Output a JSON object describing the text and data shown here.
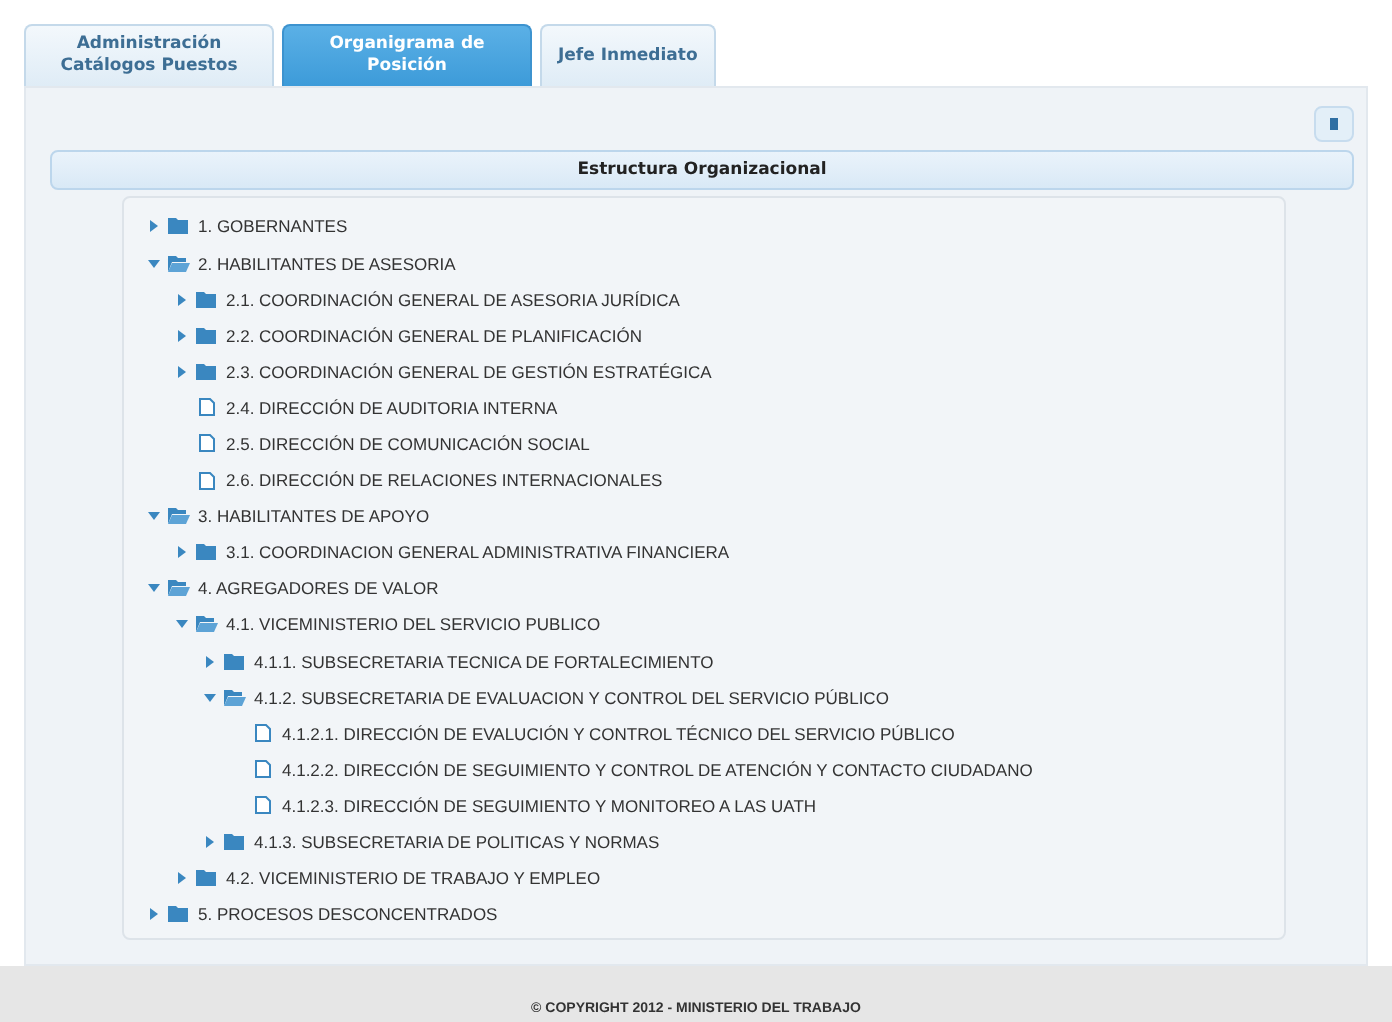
{
  "tabs": [
    {
      "label": "Administración Catálogos Puestos",
      "selected": false
    },
    {
      "label": "Organigrama de Posición",
      "selected": true
    },
    {
      "label": "Jefe Inmediato",
      "selected": false
    }
  ],
  "panel": {
    "title": "Estructura Organizacional"
  },
  "tree": [
    {
      "kind": "folder",
      "label": "1. GOBERNANTES",
      "expanded": false
    },
    {
      "kind": "folder",
      "label": "2. HABILITANTES DE ASESORIA",
      "expanded": true,
      "children": [
        {
          "kind": "folder",
          "label": "2.1. COORDINACIÓN GENERAL DE ASESORIA JURÍDICA",
          "expanded": false
        },
        {
          "kind": "folder",
          "label": "2.2. COORDINACIÓN GENERAL DE PLANIFICACIÓN",
          "expanded": false
        },
        {
          "kind": "folder",
          "label": "2.3. COORDINACIÓN GENERAL DE GESTIÓN ESTRATÉGICA",
          "expanded": false
        },
        {
          "kind": "file",
          "label": "2.4. DIRECCIÓN DE AUDITORIA INTERNA"
        },
        {
          "kind": "file",
          "label": "2.5. DIRECCIÓN DE COMUNICACIÓN SOCIAL"
        },
        {
          "kind": "file",
          "label": "2.6. DIRECCIÓN DE RELACIONES INTERNACIONALES"
        }
      ]
    },
    {
      "kind": "folder",
      "label": "3. HABILITANTES DE APOYO",
      "expanded": true,
      "children": [
        {
          "kind": "folder",
          "label": "3.1. COORDINACION GENERAL ADMINISTRATIVA FINANCIERA",
          "expanded": false
        }
      ]
    },
    {
      "kind": "folder",
      "label": "4. AGREGADORES DE VALOR",
      "expanded": true,
      "children": [
        {
          "kind": "folder",
          "label": "4.1. VICEMINISTERIO DEL SERVICIO PUBLICO",
          "expanded": true,
          "children": [
            {
              "kind": "folder",
              "label": "4.1.1. SUBSECRETARIA TECNICA DE FORTALECIMIENTO",
              "expanded": false
            },
            {
              "kind": "folder",
              "label": "4.1.2. SUBSECRETARIA DE EVALUACION Y CONTROL DEL SERVICIO PÚBLICO",
              "expanded": true,
              "children": [
                {
                  "kind": "file",
                  "label": "4.1.2.1. DIRECCIÓN DE EVALUCIÓN Y CONTROL TÉCNICO DEL SERVICIO PÚBLICO"
                },
                {
                  "kind": "file",
                  "label": "4.1.2.2. DIRECCIÓN DE SEGUIMIENTO Y CONTROL DE ATENCIÓN Y CONTACTO CIUDADANO"
                },
                {
                  "kind": "file",
                  "label": "4.1.2.3. DIRECCIÓN DE SEGUIMIENTO Y MONITOREO A LAS UATH"
                }
              ]
            },
            {
              "kind": "folder",
              "label": "4.1.3. SUBSECRETARIA DE POLITICAS Y NORMAS",
              "expanded": false
            }
          ]
        },
        {
          "kind": "folder",
          "label": "4.2. VICEMINISTERIO DE TRABAJO Y EMPLEO",
          "expanded": false
        }
      ]
    },
    {
      "kind": "folder",
      "label": "5. PROCESOS DESCONCENTRADOS",
      "expanded": false
    }
  ],
  "footer": "© COPYRIGHT 2012 - MINISTERIO DEL TRABAJO"
}
